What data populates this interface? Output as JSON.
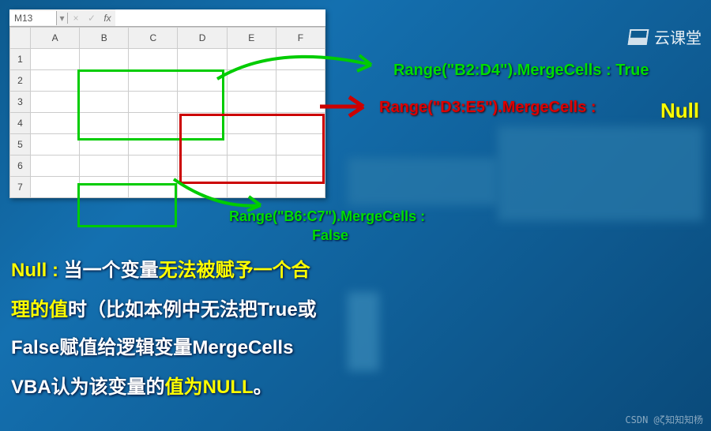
{
  "excel": {
    "cell_reference": "M13",
    "formula_value": "",
    "columns": [
      "A",
      "B",
      "C",
      "D",
      "E",
      "F"
    ],
    "rows": [
      "1",
      "2",
      "3",
      "4",
      "5",
      "6",
      "7"
    ]
  },
  "annotations": {
    "range1": {
      "code": "Range(\"B2:D4\").MergeCells  : ",
      "result": "True"
    },
    "range2": {
      "code": "Range(\"D3:E5\").MergeCells  :  ",
      "result": "Null"
    },
    "range3": {
      "code_line1": "Range(\"B6:C7\").MergeCells :",
      "code_line2": "False"
    }
  },
  "explanation": {
    "l1a": "Null  :  ",
    "l1b": "当一个变量",
    "l1c": "无法被赋予一个合",
    "l2a": "理的值",
    "l2b": "时（比如本例中无法把True或",
    "l3": "False赋值给逻辑变量MergeCells",
    "l4a": "VBA认为该变量的",
    "l4b": "值为NULL",
    "l4c": "。"
  },
  "logo_text": "云课堂",
  "watermark": "CSDN @ζ知知知杨"
}
